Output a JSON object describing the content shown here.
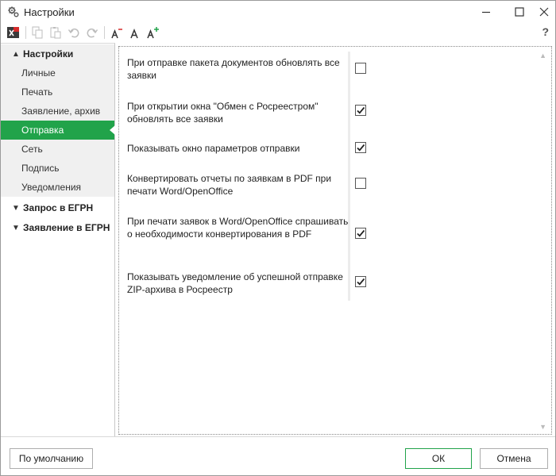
{
  "window": {
    "title": "Настройки"
  },
  "toolbar": {
    "help_label": "?"
  },
  "sidebar": {
    "groups": [
      {
        "label": "Настройки",
        "items": [
          "Личные",
          "Печать",
          "Заявление, архив",
          "Отправка",
          "Сеть",
          "Подпись",
          "Уведомления"
        ]
      },
      {
        "label": "Запрос в ЕГРН"
      },
      {
        "label": "Заявление в ЕГРН"
      }
    ],
    "active_item": "Отправка"
  },
  "options": [
    {
      "label": "При отправке пакета документов обновлять все заявки",
      "checked": false
    },
    {
      "label": "При открытии окна \"Обмен с Росреестром\" обновлять все заявки",
      "checked": true
    },
    {
      "label": "Показывать окно параметров отправки",
      "checked": true
    },
    {
      "label": "Конвертировать отчеты по заявкам в PDF при печати Word/OpenOffice",
      "checked": false
    },
    {
      "label": "При печати заявок в Word/OpenOffice спрашивать о необходимости конвертирования в PDF",
      "checked": true
    },
    {
      "label": "Показывать уведомление об успешной отправке ZIP-архива в Росреестр",
      "checked": true
    }
  ],
  "footer": {
    "default_label": "По умолчанию",
    "ok_label": "ОК",
    "cancel_label": "Отмена"
  },
  "colors": {
    "accent": "#21a34a"
  }
}
